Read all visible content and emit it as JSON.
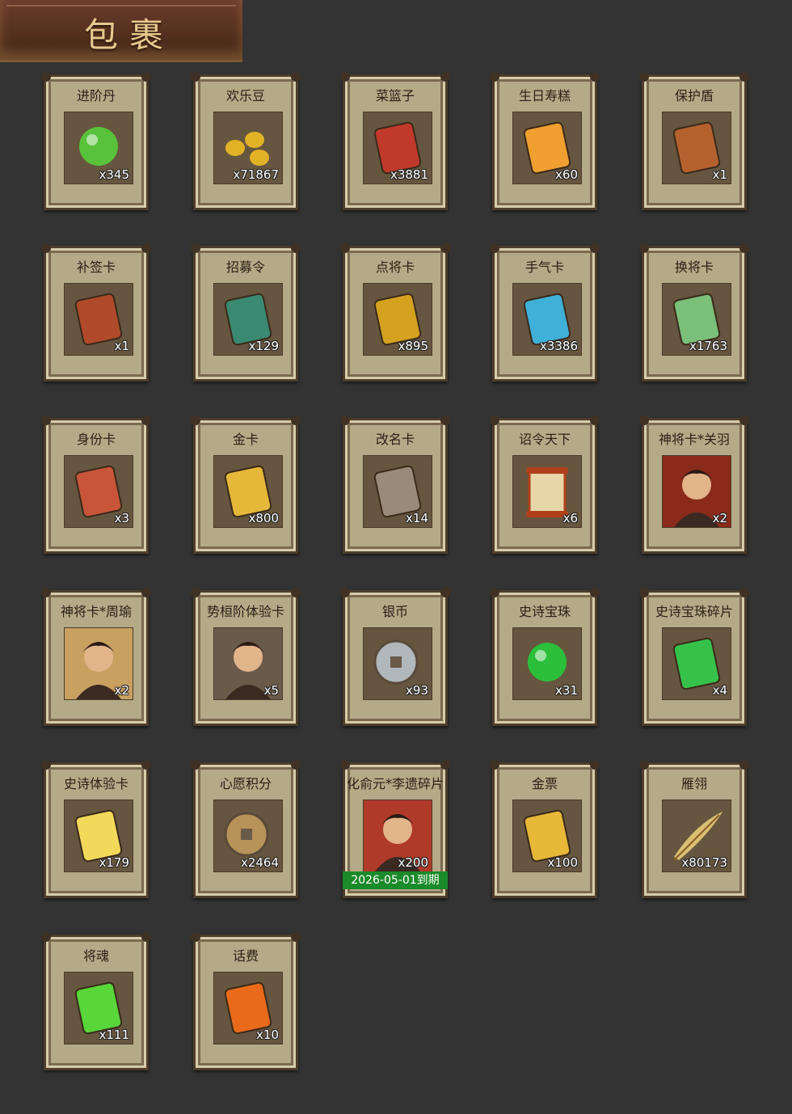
{
  "title": "包裹",
  "items": [
    {
      "name": "进阶丹",
      "qty": "x345",
      "icon": "green-orb-icon",
      "color": "#58c23a"
    },
    {
      "name": "欢乐豆",
      "qty": "x71867",
      "icon": "gold-beans-icon",
      "color": "#e2b226"
    },
    {
      "name": "菜篮子",
      "qty": "x3881",
      "icon": "basket-icon",
      "color": "#c0392b"
    },
    {
      "name": "生日寿糕",
      "qty": "x60",
      "icon": "cake-icon",
      "color": "#f0a030"
    },
    {
      "name": "保护盾",
      "qty": "x1",
      "icon": "shield-icon",
      "color": "#b5612e"
    },
    {
      "name": "补签卡",
      "qty": "x1",
      "icon": "token-card-icon",
      "color": "#b04a2a"
    },
    {
      "name": "招募令",
      "qty": "x129",
      "icon": "recruit-order-icon",
      "color": "#3a8a72"
    },
    {
      "name": "点将卡",
      "qty": "x895",
      "icon": "general-card-icon",
      "color": "#d4a21e"
    },
    {
      "name": "手气卡",
      "qty": "x3386",
      "icon": "luck-card-icon",
      "color": "#3fb0d8"
    },
    {
      "name": "换将卡",
      "qty": "x1763",
      "icon": "swap-card-icon",
      "color": "#7ac07a"
    },
    {
      "name": "身份卡",
      "qty": "x3",
      "icon": "mask-card-icon",
      "color": "#c8553a"
    },
    {
      "name": "金卡",
      "qty": "x800",
      "icon": "gold-card-icon",
      "color": "#e6b83a"
    },
    {
      "name": "改名卡",
      "qty": "x14",
      "icon": "rename-card-icon",
      "color": "#9a8a7a"
    },
    {
      "name": "诏令天下",
      "qty": "x6",
      "icon": "scroll-icon",
      "color": "#e6d6a8"
    },
    {
      "name": "神将卡*关羽",
      "qty": "x2",
      "icon": "portrait-icon",
      "color": "#8a2a1a"
    },
    {
      "name": "神将卡*周瑜",
      "qty": "x2",
      "icon": "portrait-icon",
      "color": "#c8a060"
    },
    {
      "name": "势桓阶体验卡",
      "qty": "x5",
      "icon": "portrait-icon",
      "color": "#6a5a4a"
    },
    {
      "name": "银币",
      "qty": "x93",
      "icon": "silver-coin-icon",
      "color": "#b0b8bc"
    },
    {
      "name": "史诗宝珠",
      "qty": "x31",
      "icon": "green-pearl-icon",
      "color": "#2bbf3a"
    },
    {
      "name": "史诗宝珠碎片",
      "qty": "x4",
      "icon": "jade-shard-icon",
      "color": "#36c24a"
    },
    {
      "name": "史诗体验卡",
      "qty": "x179",
      "icon": "yellow-card-icon",
      "color": "#f2d95a"
    },
    {
      "name": "心愿积分",
      "qty": "x2464",
      "icon": "heart-coin-icon",
      "color": "#b7935a"
    },
    {
      "name": "化俞元*李遗碎片",
      "qty": "x200",
      "icon": "portrait-icon",
      "color": "#b03a2a",
      "expiry": "2026-05-01到期"
    },
    {
      "name": "金票",
      "qty": "x100",
      "icon": "gold-ticket-icon",
      "color": "#e8b838"
    },
    {
      "name": "雁翎",
      "qty": "x80173",
      "icon": "feather-icon",
      "color": "#d8c070"
    },
    {
      "name": "将魂",
      "qty": "x111",
      "icon": "soul-crystal-icon",
      "color": "#58d63a"
    },
    {
      "name": "话费",
      "qty": "x10",
      "icon": "phone-fee-card-icon",
      "color": "#e86a1a"
    }
  ]
}
